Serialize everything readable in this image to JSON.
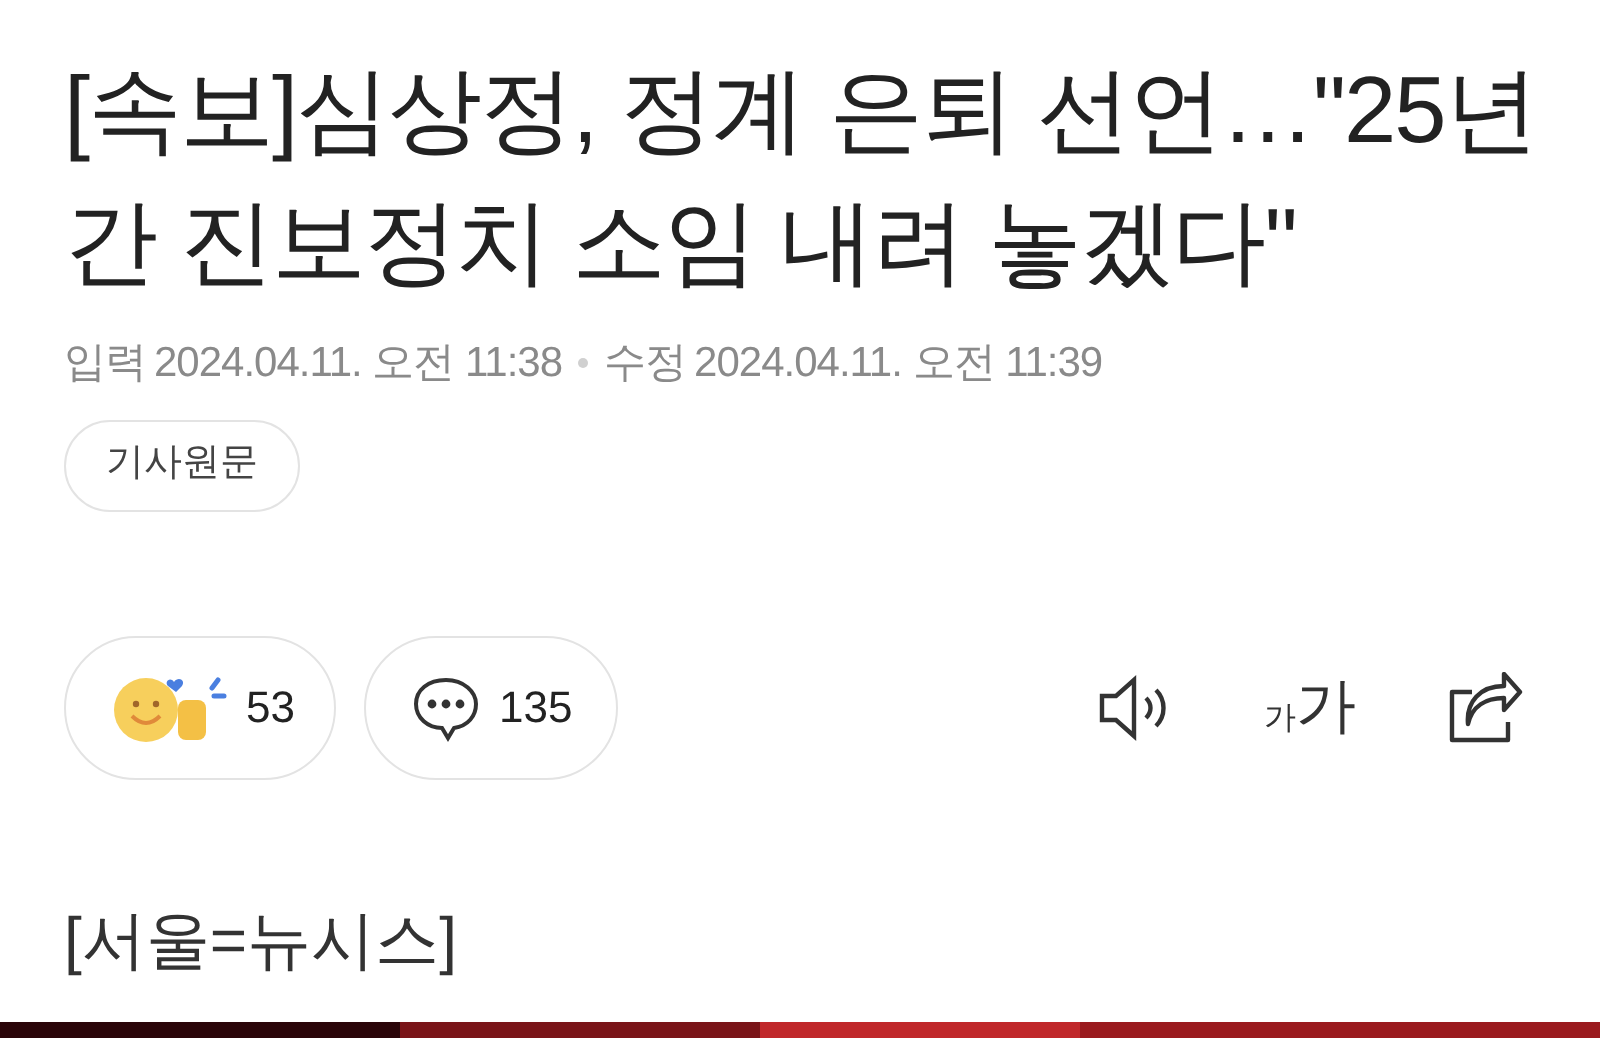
{
  "headline": "[속보]심상정, 정계 은퇴 선언…\"25년간 진보정치 소임 내려 놓겠다\"",
  "meta": {
    "input_label": "입력",
    "input_time": "2024.04.11. 오전 11:38",
    "edit_label": "수정",
    "edit_time": "2024.04.11. 오전 11:39"
  },
  "original_button": "기사원문",
  "reactions": [
    {
      "kind": "like",
      "count": "53"
    },
    {
      "kind": "comment",
      "count": "135"
    }
  ],
  "font_size_button": {
    "small": "가",
    "large": "가"
  },
  "body": {
    "dateline": "[서울=뉴시스]"
  }
}
